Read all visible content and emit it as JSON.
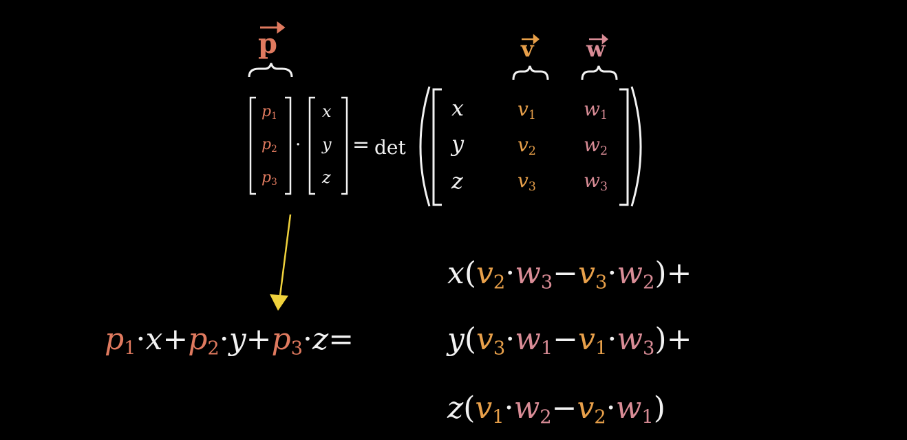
{
  "colors": {
    "p": "#e07a5f",
    "v": "#e8a04a",
    "w": "#d98c96",
    "text": "#f2f2f2",
    "arrow": "#f0d23c",
    "bg": "#000000"
  },
  "top": {
    "label_p": "p",
    "label_v": "v",
    "label_w": "w",
    "vec_p": [
      [
        "p",
        "1"
      ],
      [
        "p",
        "2"
      ],
      [
        "p",
        "3"
      ]
    ],
    "vec_xyz": [
      "x",
      "y",
      "z"
    ],
    "dot": "·",
    "equals": "=",
    "det": "det",
    "mat_col1": [
      "x",
      "y",
      "z"
    ],
    "mat_col2": [
      [
        "v",
        "1"
      ],
      [
        "v",
        "2"
      ],
      [
        "v",
        "3"
      ]
    ],
    "mat_col3": [
      [
        "w",
        "1"
      ],
      [
        "w",
        "2"
      ],
      [
        "w",
        "3"
      ]
    ]
  },
  "bottom": {
    "lhs": {
      "p1": "p",
      "s1": "1",
      "x": "x",
      "plus": "+",
      "p2": "p",
      "s2": "2",
      "y": "y",
      "p3": "p",
      "s3": "3",
      "z": "z",
      "equals": "="
    },
    "row1": {
      "var": "x",
      "open": "(",
      "a": "v",
      "as": "2",
      "b": "w",
      "bs": "3",
      "minus": "−",
      "c": "v",
      "cs": "3",
      "d": "w",
      "ds": "2",
      "close": ")",
      "plus": "+"
    },
    "row2": {
      "var": "y",
      "open": "(",
      "a": "v",
      "as": "3",
      "b": "w",
      "bs": "1",
      "minus": "−",
      "c": "v",
      "cs": "1",
      "d": "w",
      "ds": "3",
      "close": ")",
      "plus": "+"
    },
    "row3": {
      "var": "z",
      "open": "(",
      "a": "v",
      "as": "1",
      "b": "w",
      "bs": "2",
      "minus": "−",
      "c": "v",
      "cs": "2",
      "d": "w",
      "ds": "1",
      "close": ")",
      "plus": ""
    }
  }
}
